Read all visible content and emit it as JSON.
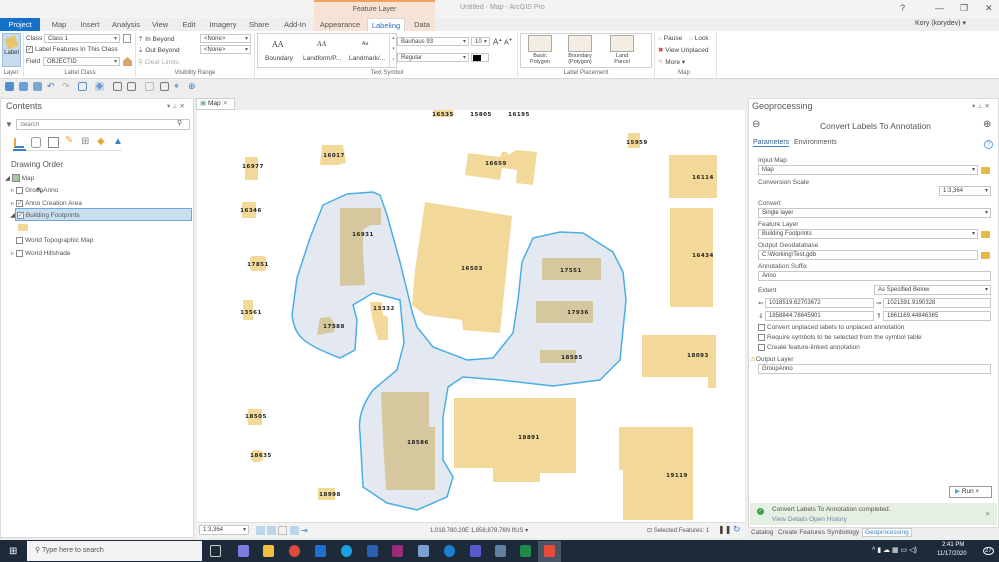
{
  "window": {
    "title": "Untitled - Map - ArcGIS Pro",
    "context_tab_group": "Feature Layer",
    "help": "?",
    "minimize": "—",
    "restore": "❐",
    "close": "✕",
    "user": "Kory (korydev) ▾"
  },
  "tabs": [
    "Project",
    "Map",
    "Insert",
    "Analysis",
    "View",
    "Edit",
    "Imagery",
    "Share",
    "Add-In",
    "Appearance",
    "Labeling",
    "Data"
  ],
  "ribbon": {
    "layer": {
      "button": "Label",
      "group": "Layer"
    },
    "label_class": {
      "class_label": "Class",
      "class_value": "Class 1",
      "label_features": "Label Features In This Class",
      "field_label": "Field",
      "field_value": "OBJECTID",
      "group": "Label Class"
    },
    "visibility": {
      "in_beyond": "In Beyond",
      "out_beyond": "Out Beyond",
      "clear_limits": "Clear Limits",
      "in_value": "<None>",
      "out_value": "<None>",
      "group": "Visibility Range"
    },
    "text_symbol": {
      "styles": [
        "Boundary",
        "Landform/P...",
        "Landmark/..."
      ],
      "previews": [
        "AA",
        "AA",
        "Aa"
      ],
      "font": "Bauhaus 93",
      "size": "10",
      "style": "Regular",
      "group": "Text Symbol"
    },
    "placement": {
      "items": [
        "Basic Polygon",
        "Boundary (Polygon)",
        "Land Parcel"
      ],
      "group": "Label Placement"
    },
    "map": {
      "pause": "Pause",
      "lock": "Lock",
      "view_unplaced": "View Unplaced",
      "more": "More ▾",
      "group": "Map"
    }
  },
  "contents": {
    "title": "Contents",
    "search_placeholder": "Search",
    "heading": "Drawing Order",
    "layers": [
      {
        "name": "Map",
        "checked": true
      },
      {
        "name": "GroupAnno",
        "checked": false
      },
      {
        "name": "Anno Creation Area",
        "checked": true
      },
      {
        "name": "Building Footprints",
        "checked": true
      },
      {
        "name": "World Topographic Map",
        "checked": false
      },
      {
        "name": "World Hillshade",
        "checked": false
      }
    ]
  },
  "map": {
    "tab": "Map",
    "buildings": [
      "16535",
      "15805",
      "16195",
      "15959",
      "16017",
      "16977",
      "16659",
      "16114",
      "16346",
      "16931",
      "16503",
      "17851",
      "17551",
      "16434",
      "13561",
      "13332",
      "17588",
      "17936",
      "18585",
      "18093",
      "18505",
      "18586",
      "18891",
      "19119",
      "18635",
      "18998"
    ],
    "colors": {
      "building": "#f2d99a",
      "selected": "#d6c89e",
      "buffer": "#e4e9f1",
      "buffer_line": "#4aaee6"
    }
  },
  "status": {
    "scale": "1:3,364",
    "coords": "1,018,780.20E 1,858,879.76N ftUS",
    "selected": "Selected Features: 1"
  },
  "geoprocessing": {
    "title": "Geoprocessing",
    "tool": "Convert Labels To Annotation",
    "tabs": [
      "Parameters",
      "Environments"
    ],
    "input_map_label": "Input Map",
    "input_map": "Map",
    "scale_label": "Conversion Scale",
    "scale": "1:3,364",
    "convert_label": "Convert",
    "convert": "Single layer",
    "feature_layer_label": "Feature Layer",
    "feature_layer": "Building Footprints",
    "gdb_label": "Output Geodatabase",
    "gdb": "C:\\Working\\Test.gdb",
    "suffix_label": "Annotation Suffix",
    "suffix": "Anno",
    "extent_label": "Extent",
    "extent": "As Specified Below",
    "left": "1018519.62703672",
    "right": "1021591.9190328",
    "bottom": "1858844.78645901",
    "top": "1861169.44846365",
    "checks": [
      "Convert unplaced labels to unplaced annotation",
      "Require symbols to be selected from the symbol table",
      "Create feature-linked annotation"
    ],
    "output_label": "Output Layer",
    "output": "GroupAnno",
    "run": "Run",
    "message": "Convert Labels To Annotation completed.",
    "view_details": "View Details",
    "open_history": "Open History",
    "bottom_tabs": [
      "Catalog",
      "Create Features",
      "Symbology",
      "Geoprocessing"
    ]
  },
  "taskbar": {
    "search_placeholder": "Type here to search",
    "time": "2:41 PM",
    "date": "11/17/2020",
    "notifications": "27"
  }
}
